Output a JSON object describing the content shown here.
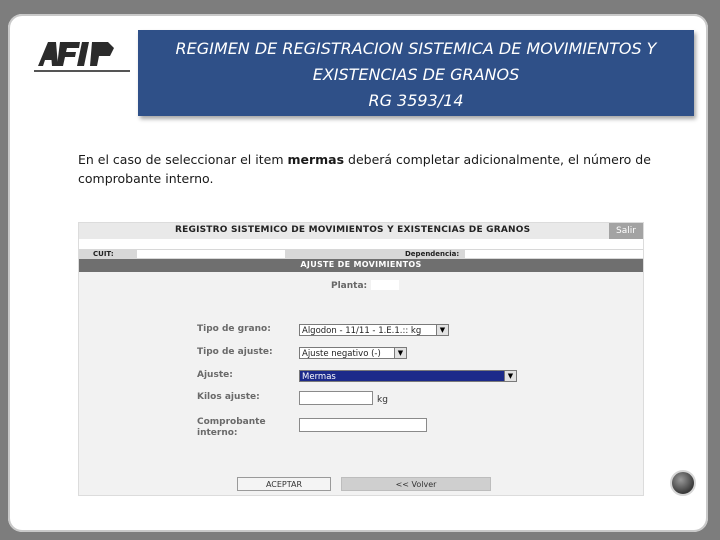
{
  "slide": {
    "title_line1": "REGIMEN DE REGISTRACION SISTEMICA DE MOVIMIENTOS Y",
    "title_line2": "EXISTENCIAS DE GRANOS",
    "title_line3": "RG 3593/14",
    "desc_part1": "En el caso de seleccionar el item ",
    "desc_bold": "mermas",
    "desc_part2": " deberá completar adicionalmente, el número de comprobante interno."
  },
  "colors": {
    "title_bg": "#2f5088",
    "ajuste_bar": "#6f6f6f",
    "selected": "#1c2a8a"
  },
  "app": {
    "header_title": "REGISTRO SISTEMICO DE MOVIMIENTOS Y EXISTENCIAS DE GRANOS",
    "salir_label": "Salir",
    "cuit_label": "CUIT:",
    "dependencia_label": "Dependencia:",
    "section_title": "AJUSTE DE MOVIMIENTOS",
    "planta_label": "Planta:",
    "fields": {
      "tipo_grano_label": "Tipo de grano:",
      "tipo_grano_value": "Algodon - 11/11 - 1.E.1.:: kg",
      "tipo_ajuste_label": "Tipo de ajuste:",
      "tipo_ajuste_value": "Ajuste negativo (-)",
      "ajuste_label": "Ajuste:",
      "ajuste_value": "Mermas",
      "kilos_label": "Kilos ajuste:",
      "kilos_unit": "kg",
      "comprobante_label_line1": "Comprobante",
      "comprobante_label_line2": "interno:"
    },
    "buttons": {
      "aceptar": "ACEPTAR",
      "volver": "<< Volver"
    }
  }
}
